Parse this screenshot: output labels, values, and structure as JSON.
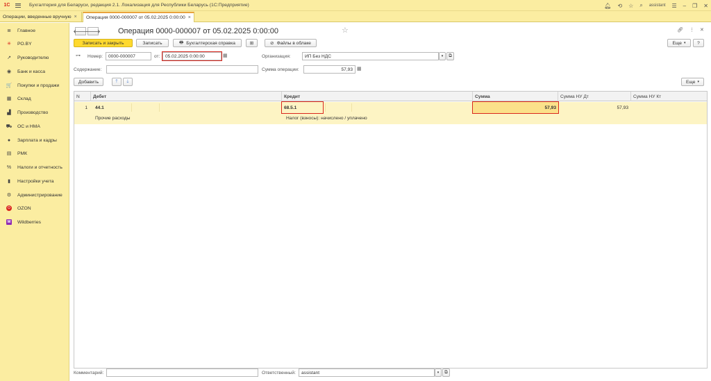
{
  "titlebar": {
    "logo": "1С",
    "title": "Бухгалтерия для Беларуси, редакция 2.1. Локализация для Республики Беларусь   (1С:Предприятие)",
    "user": "assistant"
  },
  "tabs": [
    {
      "label": "Операции, введенные вручную"
    },
    {
      "label": "Операция 0000-000007 от 05.02.2025 0:00:00"
    }
  ],
  "sidebar": {
    "items": [
      {
        "label": "Главное",
        "icon": "≣"
      },
      {
        "label": "РО.BY",
        "icon": "✳"
      },
      {
        "label": "Руководителю",
        "icon": "↗"
      },
      {
        "label": "Банк и касса",
        "icon": "◉"
      },
      {
        "label": "Покупки и продажи",
        "icon": "🛒"
      },
      {
        "label": "Склад",
        "icon": "▦"
      },
      {
        "label": "Производство",
        "icon": "▟"
      },
      {
        "label": "ОС и НМА",
        "icon": "⛟"
      },
      {
        "label": "Зарплата и кадры",
        "icon": "●"
      },
      {
        "label": "РМК",
        "icon": "▤"
      },
      {
        "label": "Налоги и отчетность",
        "icon": "%"
      },
      {
        "label": "Настройки учета",
        "icon": "▮"
      },
      {
        "label": "Администрирование",
        "icon": "⚙"
      },
      {
        "label": "OZON",
        "icon": "O"
      },
      {
        "label": "Wildberries",
        "icon": "W"
      }
    ]
  },
  "doc": {
    "title": "Операция 0000-000007 от 05.02.2025 0:00:00",
    "toolbar": {
      "save_close": "Записать и закрыть",
      "save": "Записать",
      "acc_report": "Бухгалтерская справка",
      "files": "Файлы в облаке",
      "more": "Еще",
      "help": "?"
    },
    "number_label": "Номер:",
    "number_value": "0000-000007",
    "date_label": "от:",
    "date_value": "05.02.2025  0:00:00",
    "org_label": "Организация:",
    "org_value": "ИП Без НДС",
    "content_label": "Содержание:",
    "content_value": "",
    "sum_label": "Сумма операции:",
    "sum_value": "57,93",
    "add_button": "Добавить",
    "table_more": "Еще",
    "comment_label": "Комментарий:",
    "comment_value": "",
    "responsible_label": "Ответственный:",
    "responsible_value": "assistant"
  },
  "table": {
    "headers": {
      "n": "N",
      "debit": "Дебет",
      "credit": "Кредит",
      "sum": "Сумма",
      "sum_nu_dt": "Сумма НУ Дт",
      "sum_nu_kt": "Сумма НУ Кт"
    },
    "rows": [
      {
        "n": "1",
        "debit": "44.1",
        "debit_sub": "Прочие расходы",
        "credit": "68.5.1",
        "credit_sub": "Налог (взносы): начислено / уплачено",
        "sum": "57,93",
        "sum_nu_dt": "57,93",
        "sum_nu_kt": ""
      }
    ]
  }
}
